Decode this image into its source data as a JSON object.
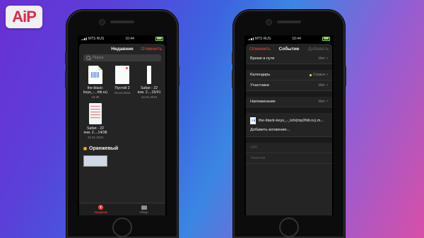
{
  "logo": {
    "text": "AiP"
  },
  "left_phone": {
    "status": {
      "carrier": "MTS RUS",
      "time": "16:44"
    },
    "nav": {
      "title": "Недавние",
      "cancel": "Отменить"
    },
    "search": {
      "placeholder": "Поиск"
    },
    "files": [
      {
        "name1": "the-black-",
        "name2": "keys_-...hiti.ru)",
        "date": "16:39"
      },
      {
        "name1": "Пустой 2",
        "name2": "",
        "date": "05.04.2018"
      },
      {
        "name1": "Safari - 22",
        "name2": "янв. 2....15/41",
        "date": "22.01.2018"
      },
      {
        "name1": "Safari - 22",
        "name2": "янв. 2....14/38",
        "date": "22.01.2018"
      }
    ],
    "tag": {
      "label": "Оранжевый",
      "color": "#f5a623"
    },
    "tabs": [
      {
        "label": "Недавние"
      },
      {
        "label": "Обзор"
      }
    ]
  },
  "right_phone": {
    "status": {
      "carrier": "MTS RUS",
      "time": "16:44"
    },
    "nav": {
      "cancel": "Отменить",
      "title": "Событие",
      "add": "Добавить"
    },
    "rows": {
      "travel": {
        "label": "Время в пути",
        "value": "Нет"
      },
      "calendar": {
        "label": "Календарь",
        "value": "Семья"
      },
      "invitees": {
        "label": "Участники",
        "value": "Нет"
      },
      "alert": {
        "label": "Напоминание",
        "value": "Нет"
      }
    },
    "attachment": {
      "name": "the-black-keys_-_lohi(mp3hiti.ru).m..."
    },
    "add_attachment": "Добавить вложение...",
    "url_placeholder": "URL",
    "notes_placeholder": "Заметки"
  }
}
